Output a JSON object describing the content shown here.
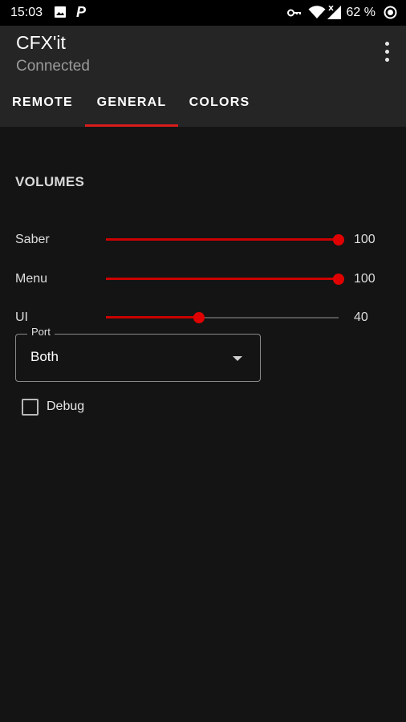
{
  "status_bar": {
    "time": "15:03",
    "icons": [
      "image-icon",
      "parking-p-icon",
      "vpn-key-icon",
      "wifi-icon",
      "signal-no-data-icon",
      "battery-saver-icon"
    ],
    "battery": "62 %"
  },
  "app_bar": {
    "title": "CFX'it",
    "subtitle": "Connected",
    "menu_icon": "more-vert-icon"
  },
  "tabs": [
    {
      "label": "REMOTE",
      "active": false
    },
    {
      "label": "GENERAL",
      "active": true
    },
    {
      "label": "COLORS",
      "active": false
    }
  ],
  "volumes": {
    "title": "VOLUMES",
    "items": [
      {
        "label": "Saber",
        "value": "100",
        "max": 100
      },
      {
        "label": "Menu",
        "value": "100",
        "max": 100
      },
      {
        "label": "UI",
        "value": "40",
        "max": 100
      }
    ]
  },
  "port": {
    "label": "Port",
    "value": "Both"
  },
  "debug": {
    "label": "Debug",
    "checked": false
  },
  "colors": {
    "accent": "#d81c1c",
    "background": "#141414",
    "app_bar": "#252525"
  }
}
